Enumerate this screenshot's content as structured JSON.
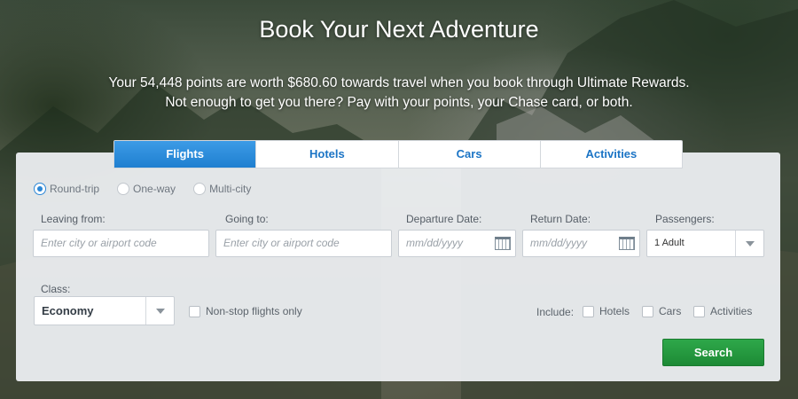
{
  "hero": {
    "title": "Book Your Next Adventure",
    "subtitle_line1": "Your 54,448 points are worth $680.60 towards travel when you book through Ultimate Rewards.",
    "subtitle_line2": "Not enough to get you there? Pay with your points, your Chase card, or both."
  },
  "tabs": [
    {
      "label": "Flights",
      "active": true
    },
    {
      "label": "Hotels",
      "active": false
    },
    {
      "label": "Cars",
      "active": false
    },
    {
      "label": "Activities",
      "active": false
    }
  ],
  "trip_type": {
    "options": [
      "Round-trip",
      "One-way",
      "Multi-city"
    ],
    "selected": "Round-trip"
  },
  "fields": {
    "leaving_from": {
      "label": "Leaving from:",
      "placeholder": "Enter city or airport code"
    },
    "going_to": {
      "label": "Going to:",
      "placeholder": "Enter city or airport code"
    },
    "departure_date": {
      "label": "Departure Date:",
      "placeholder": "mm/dd/yyyy"
    },
    "return_date": {
      "label": "Return Date:",
      "placeholder": "mm/dd/yyyy"
    },
    "passengers": {
      "label": "Passengers:",
      "value": "1 Adult"
    },
    "class": {
      "label": "Class:",
      "value": "Economy"
    }
  },
  "options": {
    "nonstop_label": "Non-stop flights only",
    "include_label": "Include:",
    "include_items": [
      "Hotels",
      "Cars",
      "Activities"
    ]
  },
  "search_button": "Search",
  "colors": {
    "tab_active": "#1f7fd0",
    "tab_text": "#1b74c5",
    "search_button": "#2ea84a"
  }
}
